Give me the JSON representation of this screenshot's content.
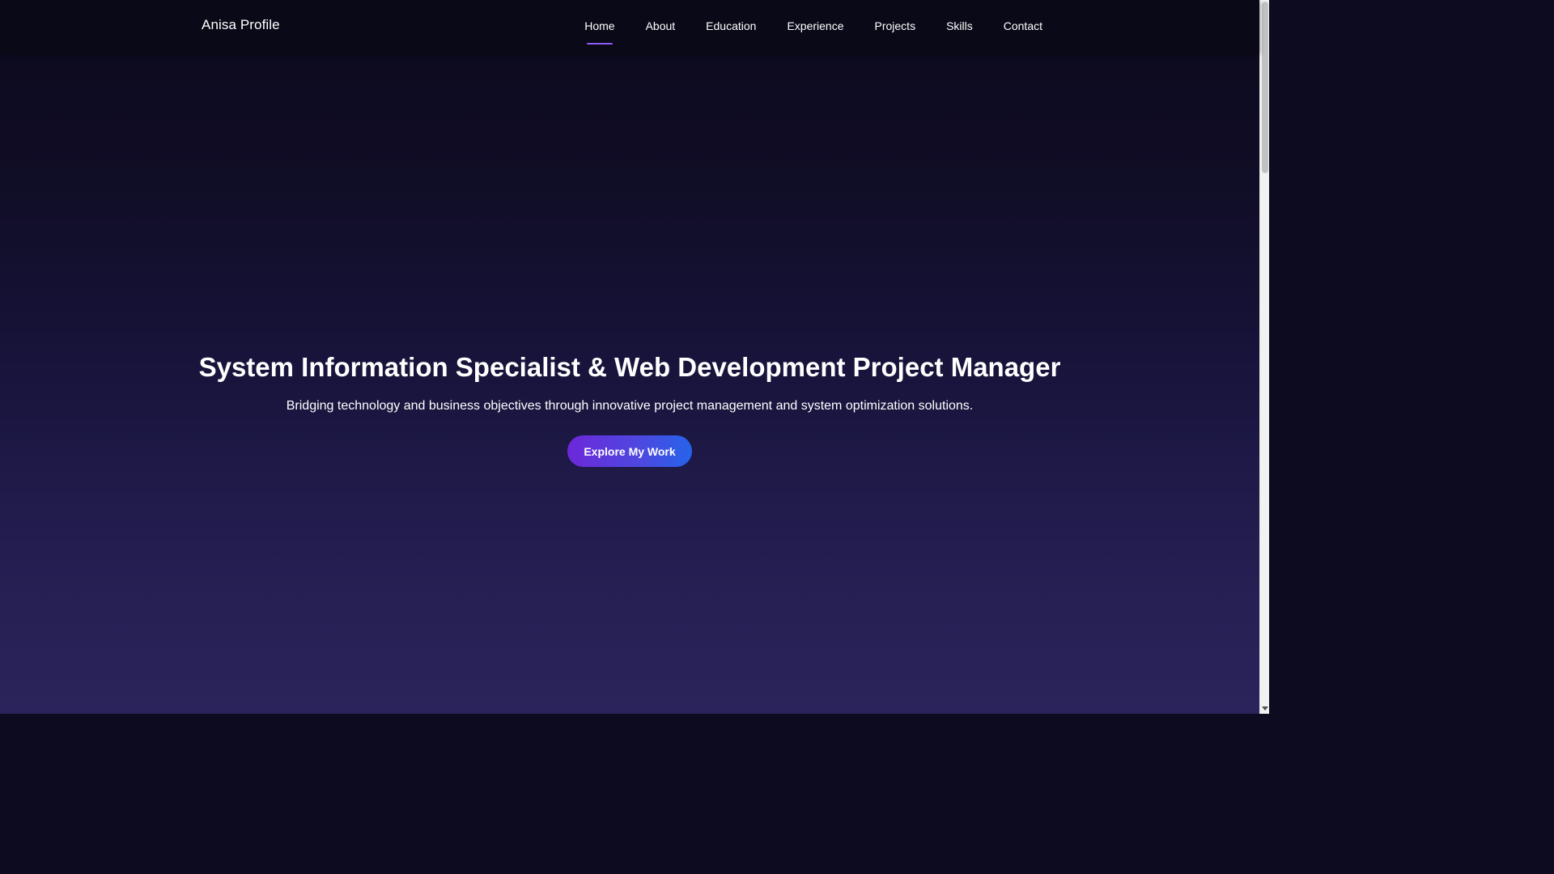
{
  "header": {
    "brand": "Anisa Profile",
    "nav": [
      {
        "label": "Home",
        "active": true
      },
      {
        "label": "About",
        "active": false
      },
      {
        "label": "Education",
        "active": false
      },
      {
        "label": "Experience",
        "active": false
      },
      {
        "label": "Projects",
        "active": false
      },
      {
        "label": "Skills",
        "active": false
      },
      {
        "label": "Contact",
        "active": false
      }
    ]
  },
  "hero": {
    "title": "System Information Specialist & Web Development Project Manager",
    "subtitle": "Bridging technology and business objectives through innovative project management and system optimization solutions.",
    "cta_label": "Explore My Work"
  },
  "colors": {
    "accent": "#8b5cf6",
    "button_start": "#6d28d9",
    "button_end": "#2563eb",
    "bg_top": "#0c0a1d",
    "bg_bottom": "#2b245c"
  },
  "icons": {
    "scroll_down": "chevron-down-icon"
  }
}
